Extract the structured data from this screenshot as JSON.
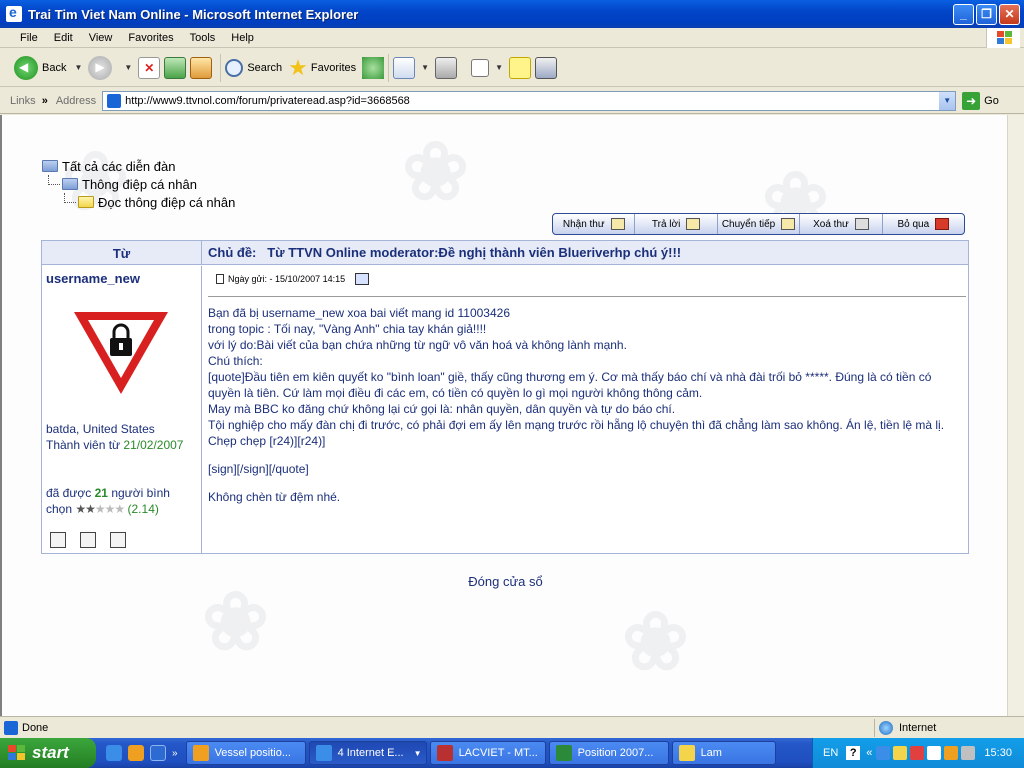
{
  "window": {
    "title": "Trai Tim Viet Nam Online - Microsoft Internet Explorer",
    "minimize": "_",
    "maximize": "❐",
    "close": "✕"
  },
  "menu": [
    "File",
    "Edit",
    "View",
    "Favorites",
    "Tools",
    "Help"
  ],
  "toolbar": {
    "back": "Back",
    "search": "Search",
    "favorites": "Favorites"
  },
  "addressbar": {
    "links": "Links",
    "address_label": "Address",
    "url": "http://www9.ttvnol.com/forum/privateread.asp?id=3668568",
    "go": "Go"
  },
  "breadcrumb": {
    "level1": "Tất cả các diễn đàn",
    "level2": "Thông điệp cá nhân",
    "level3": "Đọc thông điệp cá nhân"
  },
  "actions": {
    "inbox": "Nhận thư",
    "reply": "Trả lời",
    "forward": "Chuyển tiếp",
    "delete": "Xoá thư",
    "skip": "Bỏ qua"
  },
  "message": {
    "from_header": "Từ",
    "subject_prefix": "Chủ đề:",
    "subject": "Từ TTVN Online moderator:Đề nghị thành viên Blueriverhp chú ý!!!",
    "sender": "username_new",
    "location": "batda, United States",
    "member_since_label": "Thành viên từ",
    "member_since": "21/02/2007",
    "votes_prefix": "đã được",
    "votes_count": "21",
    "votes_suffix": "người bình chọn",
    "rating": "(2.14)",
    "stars_filled": "★★",
    "stars_empty": "★★★",
    "date_label": "Ngày gửi: - 15/10/2007  14:15",
    "body": [
      "Bạn đã bị username_new xoa bai viết mang id 11003426",
      "trong topic : Tối nay, \"Vàng Anh\" chia tay khán giả!!!!",
      "với lý do:Bài viết của bạn chứa những từ ngữ vô văn hoá và không lành mạnh.",
      "Chú thích:",
      "[quote]Đầu tiên em kiên quyết ko \"bình loan\" giề, thấy cũng thương em ý. Cơ mà thấy báo chí và nhà đài trối bỏ *****. Đúng là có tiền có quyền là tiên. Cứ làm mọi điều đi các em, có tiền có quyền lo gì mọi người không thông cảm.",
      "May mà BBC ko đăng chứ không lại cứ gọi là: nhân quyền, dân quyền và tự do báo chí.",
      "Tội nghiệp cho mấy đàn chị đi trước, có phải đợi em ấy lên mạng trước rồi hẵng lộ chuyện thì đã chẳng làm sao không. Án lệ, tiền lệ mà lị. Chẹp chẹp [r24)][r24)]"
    ],
    "sign": "[sign][/sign][/quote]",
    "footer_note": "Không chèn từ đệm nhé."
  },
  "close_window": "Đóng cửa sổ",
  "status": {
    "done": "Done",
    "zone": "Internet"
  },
  "taskbar": {
    "start": "start",
    "tasks": [
      "Vessel positio...",
      "4 Internet E...",
      "LACVIET - MT...",
      "Position 2007...",
      "Lam"
    ],
    "lang": "EN",
    "help": "?",
    "clock": "15:30"
  }
}
